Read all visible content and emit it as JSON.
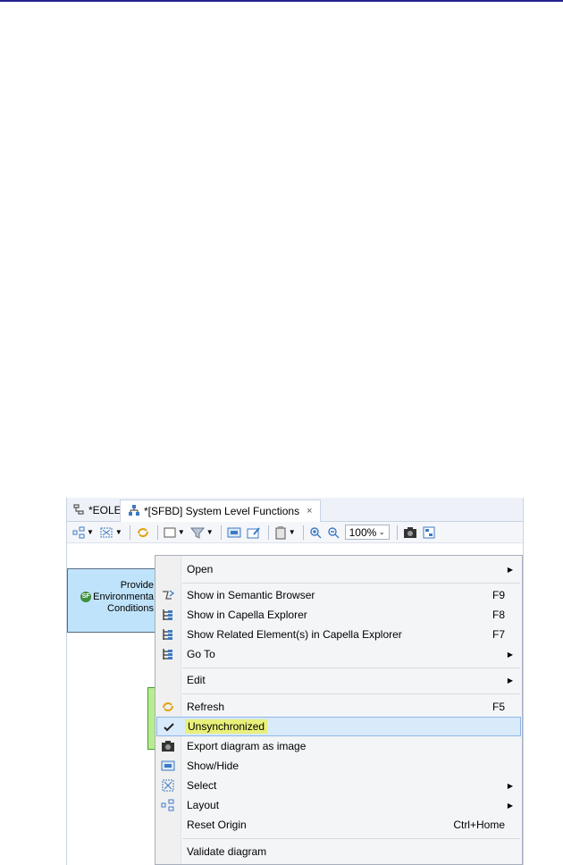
{
  "tabs": [
    {
      "label": "*EOLE",
      "active": false
    },
    {
      "label": "*[SFBD] System Level Functions",
      "active": true,
      "close": "×"
    }
  ],
  "toolbar": {
    "zoom_value": "100%"
  },
  "diagram": {
    "function_box_lines": [
      "Provide",
      "Environmenta",
      "Conditions"
    ],
    "function_badge": "SF"
  },
  "menu": {
    "items": [
      {
        "label": "Open",
        "shortcut": "",
        "submenu": true,
        "icon": ""
      },
      {
        "label": "Show in Semantic Browser",
        "shortcut": "F9",
        "submenu": false,
        "icon": "semantic-browser-icon"
      },
      {
        "label": "Show in Capella Explorer",
        "shortcut": "F8",
        "submenu": false,
        "icon": "explorer-tree-icon"
      },
      {
        "label": "Show Related Element(s) in Capella Explorer",
        "shortcut": "F7",
        "submenu": false,
        "icon": "explorer-tree-icon"
      },
      {
        "label": "Go To",
        "shortcut": "",
        "submenu": true,
        "icon": "explorer-tree-icon"
      },
      {
        "label": "Edit",
        "shortcut": "",
        "submenu": true,
        "icon": ""
      },
      {
        "label": "Refresh",
        "shortcut": "F5",
        "submenu": false,
        "icon": "refresh-icon"
      },
      {
        "label": "Unsynchronized",
        "shortcut": "",
        "submenu": false,
        "icon": "checkmark-icon",
        "selected": true
      },
      {
        "label": "Export diagram as image",
        "shortcut": "",
        "submenu": false,
        "icon": "camera-icon"
      },
      {
        "label": "Show/Hide",
        "shortcut": "",
        "submenu": false,
        "icon": "show-hide-icon"
      },
      {
        "label": "Select",
        "shortcut": "",
        "submenu": true,
        "icon": "select-icon"
      },
      {
        "label": "Layout",
        "shortcut": "",
        "submenu": true,
        "icon": "layout-icon"
      },
      {
        "label": "Reset Origin",
        "shortcut": "Ctrl+Home",
        "submenu": false,
        "icon": ""
      },
      {
        "label": "Validate diagram",
        "shortcut": "",
        "submenu": false,
        "icon": ""
      }
    ]
  },
  "colors": {
    "function_fill": "#bfe3fb",
    "highlight": "#e8f07a",
    "selection": "#d9eafb"
  }
}
